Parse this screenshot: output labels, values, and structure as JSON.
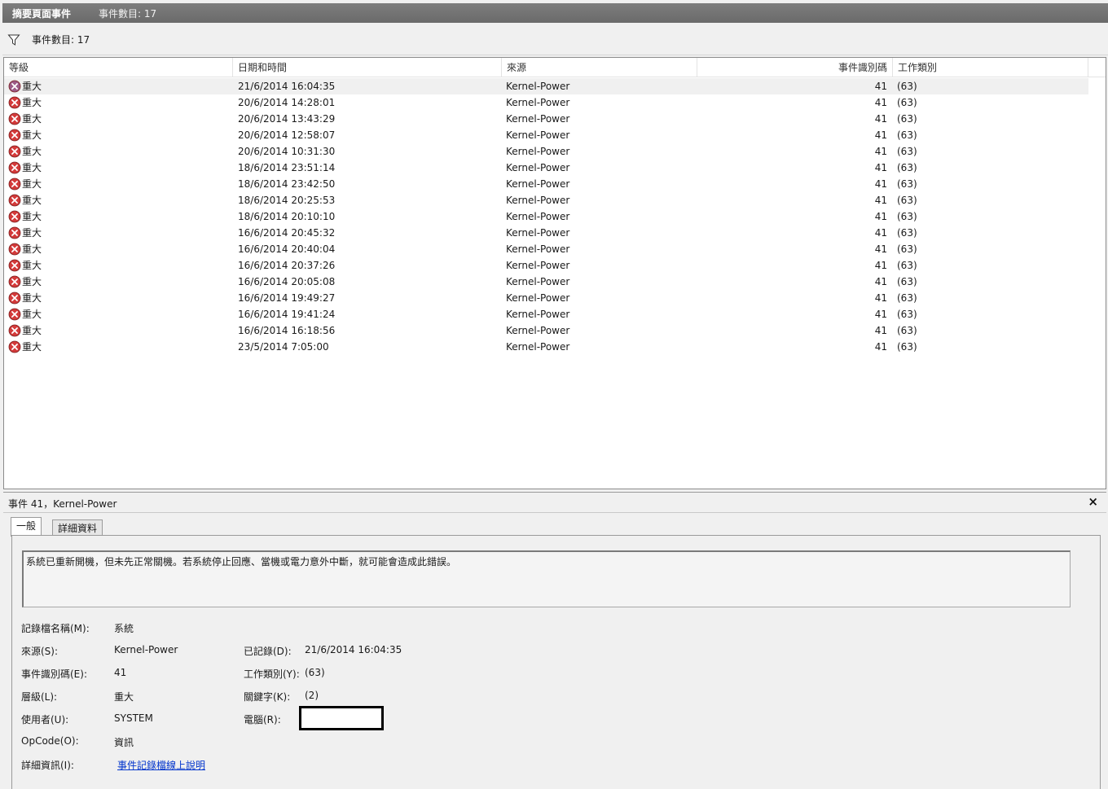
{
  "titlebar": {
    "title": "摘要頁面事件",
    "count": "事件數目: 17"
  },
  "filter": {
    "label": "事件數目: 17"
  },
  "columns": [
    "等級",
    "日期和時間",
    "來源",
    "事件識別碼",
    "工作類別"
  ],
  "rows": [
    {
      "level": "重大",
      "datetime": "21/6/2014  16:04:35",
      "source": "Kernel-Power",
      "id": "41",
      "task": "(63)"
    },
    {
      "level": "重大",
      "datetime": "20/6/2014  14:28:01",
      "source": "Kernel-Power",
      "id": "41",
      "task": "(63)"
    },
    {
      "level": "重大",
      "datetime": "20/6/2014  13:43:29",
      "source": "Kernel-Power",
      "id": "41",
      "task": "(63)"
    },
    {
      "level": "重大",
      "datetime": "20/6/2014  12:58:07",
      "source": "Kernel-Power",
      "id": "41",
      "task": "(63)"
    },
    {
      "level": "重大",
      "datetime": "20/6/2014  10:31:30",
      "source": "Kernel-Power",
      "id": "41",
      "task": "(63)"
    },
    {
      "level": "重大",
      "datetime": "18/6/2014  23:51:14",
      "source": "Kernel-Power",
      "id": "41",
      "task": "(63)"
    },
    {
      "level": "重大",
      "datetime": "18/6/2014  23:42:50",
      "source": "Kernel-Power",
      "id": "41",
      "task": "(63)"
    },
    {
      "level": "重大",
      "datetime": "18/6/2014  20:25:53",
      "source": "Kernel-Power",
      "id": "41",
      "task": "(63)"
    },
    {
      "level": "重大",
      "datetime": "18/6/2014  20:10:10",
      "source": "Kernel-Power",
      "id": "41",
      "task": "(63)"
    },
    {
      "level": "重大",
      "datetime": "16/6/2014  20:45:32",
      "source": "Kernel-Power",
      "id": "41",
      "task": "(63)"
    },
    {
      "level": "重大",
      "datetime": "16/6/2014  20:40:04",
      "source": "Kernel-Power",
      "id": "41",
      "task": "(63)"
    },
    {
      "level": "重大",
      "datetime": "16/6/2014  20:37:26",
      "source": "Kernel-Power",
      "id": "41",
      "task": "(63)"
    },
    {
      "level": "重大",
      "datetime": "16/6/2014  20:05:08",
      "source": "Kernel-Power",
      "id": "41",
      "task": "(63)"
    },
    {
      "level": "重大",
      "datetime": "16/6/2014  19:49:27",
      "source": "Kernel-Power",
      "id": "41",
      "task": "(63)"
    },
    {
      "level": "重大",
      "datetime": "16/6/2014  19:41:24",
      "source": "Kernel-Power",
      "id": "41",
      "task": "(63)"
    },
    {
      "level": "重大",
      "datetime": "16/6/2014  16:18:56",
      "source": "Kernel-Power",
      "id": "41",
      "task": "(63)"
    },
    {
      "level": "重大",
      "datetime": "23/5/2014  7:05:00",
      "source": "Kernel-Power",
      "id": "41",
      "task": "(63)"
    }
  ],
  "detail": {
    "title": "事件 41，Kernel-Power",
    "close": "×",
    "tabs": [
      "一般",
      "詳細資料"
    ],
    "description": "系統已重新開機，但未先正常關機。若系統停止回應、當機或電力意外中斷，就可能會造成此錯誤。",
    "fields": {
      "log_name_label": "記錄檔名稱(M):",
      "log_name": "系統",
      "source_label": "來源(S):",
      "source": "Kernel-Power",
      "logged_label": "已記錄(D):",
      "logged": "21/6/2014  16:04:35",
      "event_id_label": "事件識別碼(E):",
      "event_id": "41",
      "task_label": "工作類別(Y):",
      "task": "(63)",
      "level_label": "層級(L):",
      "level": "重大",
      "keywords_label": "關鍵字(K):",
      "keywords": "(2)",
      "user_label": "使用者(U):",
      "user": "SYSTEM",
      "computer_label": "電腦(R):",
      "opcode_label": "OpCode(O):",
      "opcode": "資訊",
      "more_info_label": "詳細資訊(I):",
      "more_info_link": "事件記錄檔線上說明"
    }
  }
}
